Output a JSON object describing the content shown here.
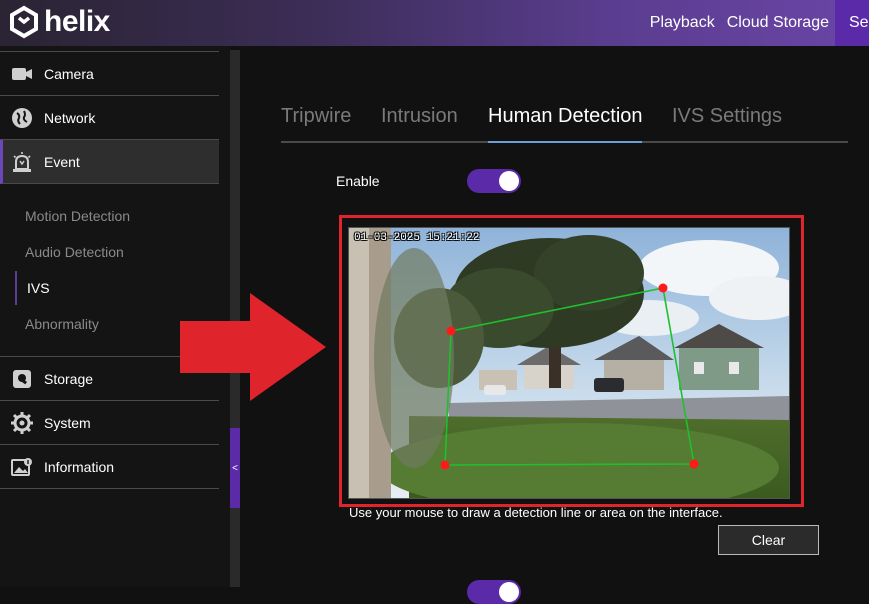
{
  "app": {
    "logo_text": "helix"
  },
  "topnav": {
    "items": [
      "Playback",
      "Cloud Storage",
      "Se"
    ]
  },
  "sidebar": {
    "items": [
      {
        "label": "Camera",
        "icon": "camera-icon"
      },
      {
        "label": "Network",
        "icon": "globe-icon"
      },
      {
        "label": "Event",
        "icon": "alarm-icon"
      },
      {
        "label": "Storage",
        "icon": "storage-icon"
      },
      {
        "label": "System",
        "icon": "gear-icon"
      },
      {
        "label": "Information",
        "icon": "image-info-icon"
      }
    ],
    "subitems": [
      "Motion Detection",
      "Audio Detection",
      "IVS",
      "Abnormality"
    ],
    "collapse_label": "<"
  },
  "tabs": [
    "Tripwire",
    "Intrusion",
    "Human Detection",
    "IVS Settings"
  ],
  "form": {
    "enable_label": "Enable",
    "enabled": true,
    "osd_timestamp": "01-03-2025 15:21:22",
    "hint": "Use your mouse to draw a detection line or area on the interface.",
    "clear_label": "Clear"
  },
  "colors": {
    "accent": "#5a2aa8",
    "highlight": "#e0242c",
    "region": "#1fbf2f",
    "vertex": "#ff1a1a"
  }
}
